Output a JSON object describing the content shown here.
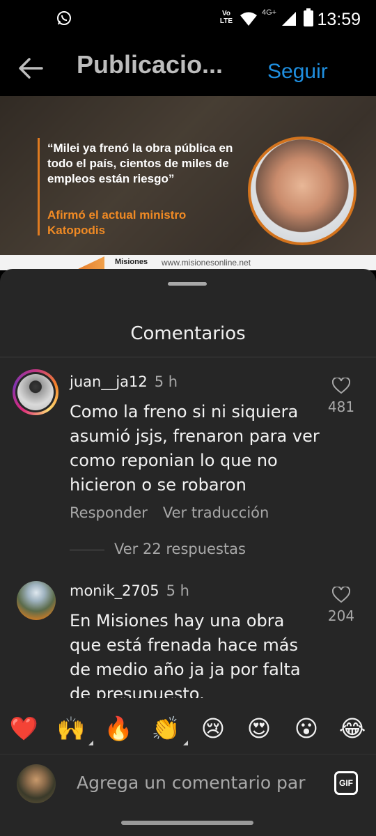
{
  "status_bar": {
    "time": "13:59",
    "volte_label": "Vo LTE",
    "network_label": "4G+",
    "icons": [
      "whatsapp-icon",
      "volte-icon",
      "wifi-icon",
      "signal-icon",
      "battery-icon"
    ]
  },
  "header": {
    "title": "Publicacio...",
    "follow_label": "Seguir"
  },
  "post": {
    "quote": "“Milei ya frenó la obra pública en todo el país, cientos de miles de empleos están riesgo”",
    "attribution": "Afirmó el actual ministro Katopodis",
    "source_name": "Misiones",
    "source_url": "www.misionesonline.net"
  },
  "comments_sheet": {
    "title": "Comentarios",
    "comments": [
      {
        "username": "juan__ja12",
        "time": "5 h",
        "text": "Como la freno si ni siquiera asumió jsjs, frenaron para ver como reponian lo que no hicieron o se robaron",
        "likes": "481",
        "reply_label": "Responder",
        "translate_label": "Ver traducción",
        "replies_label": "Ver 22 respuestas"
      },
      {
        "username": "monik_2705",
        "time": "5 h",
        "text": "En Misiones hay una obra que está frenada hace más de medio año ja ja por falta de presupuesto.",
        "likes": "204"
      }
    ]
  },
  "reactions": [
    "❤️",
    "🙌",
    "🔥",
    "👏",
    "😢",
    "😍",
    "😮",
    "😂"
  ],
  "composer": {
    "placeholder": "Agrega un comentario par",
    "gif_label": "GIF"
  },
  "colors": {
    "sheet_bg": "#262626",
    "follow_blue": "#1f8fe0",
    "accent_orange": "#e07b20"
  }
}
